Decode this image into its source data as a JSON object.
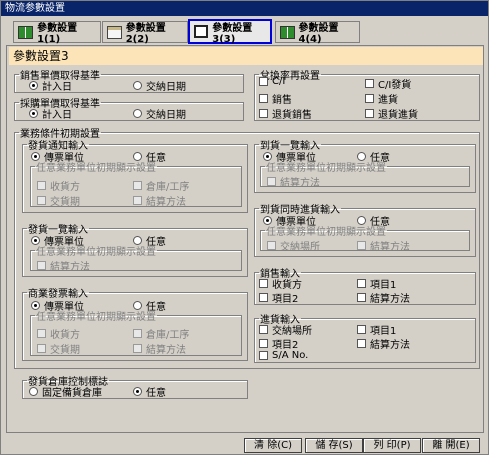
{
  "window": {
    "title": "物流参數設置"
  },
  "tabs": [
    {
      "label": "參數設置1(1)",
      "icon": "book-icon"
    },
    {
      "label": "參數設置2(2)",
      "icon": "document-icon"
    },
    {
      "label": "參數設置3(3)",
      "icon": "screen-icon"
    },
    {
      "label": "參數設置4(4)",
      "icon": "book-icon"
    }
  ],
  "active_tab": 2,
  "header": {
    "title": "參數設置3"
  },
  "sales_price_basis": {
    "legend": "銷售單價取得基準",
    "opt1": "計入日",
    "opt2": "交納日期",
    "selected": 0
  },
  "purchase_price_basis": {
    "legend": "採購單價取得基準",
    "opt1": "計入日",
    "opt2": "交納日期",
    "selected": 0
  },
  "exchange_reset": {
    "legend": "兌換率再設置",
    "items": [
      "C/I",
      "C/I發貨",
      "銷售",
      "進貨",
      "退貨銷售",
      "退貨進貨"
    ]
  },
  "biz_init": {
    "legend": "業務條件初期設置",
    "ship_notice": {
      "legend": "發貨通知輸入",
      "opt1": "傳票單位",
      "opt2": "任意",
      "sub_legend": "任意業務單位初期顯示設置",
      "items": [
        "收貨方",
        "倉庫/工序",
        "交貨期",
        "結算方法"
      ]
    },
    "ship_list": {
      "legend": "發貨一覽輸入",
      "opt1": "傳票單位",
      "opt2": "任意",
      "sub_legend": "任意業務單位初期顯示設置",
      "items": [
        "結算方法"
      ]
    },
    "invoice": {
      "legend": "商業發票輸入",
      "opt1": "傳票單位",
      "opt2": "任意",
      "sub_legend": "任意業務單位初期顯示設置",
      "items": [
        "收貨方",
        "倉庫/工序",
        "交貨期",
        "結算方法"
      ]
    },
    "arrival_list": {
      "legend": "到貨一覽輸入",
      "opt1": "傳票單位",
      "opt2": "任意",
      "sub_legend": "任意業務單位初期顯示設置",
      "items": [
        "結算方法"
      ]
    },
    "arrival_same": {
      "legend": "到貨同時進貨輸入",
      "opt1": "傳票單位",
      "opt2": "任意",
      "sub_legend": "任意業務單位初期顯示設置",
      "items": [
        "交納場所",
        "結算方法"
      ]
    },
    "sales_input": {
      "legend": "銷售輸入",
      "items": [
        "收貨方",
        "項目1",
        "項目2",
        "結算方法"
      ]
    },
    "purchase_input": {
      "legend": "進貨輸入",
      "items": [
        "交納場所",
        "項目1",
        "項目2",
        "結算方法",
        "S/A No."
      ]
    }
  },
  "warehouse_flag": {
    "legend": "發貨倉庫控制標誌",
    "opt1": "固定備貨倉庫",
    "opt2": "任意",
    "selected": 1
  },
  "buttons": {
    "clear": "清 除(C)",
    "save": "儲 存(S)",
    "print": "列 印(P)",
    "close": "離 開(E)"
  }
}
